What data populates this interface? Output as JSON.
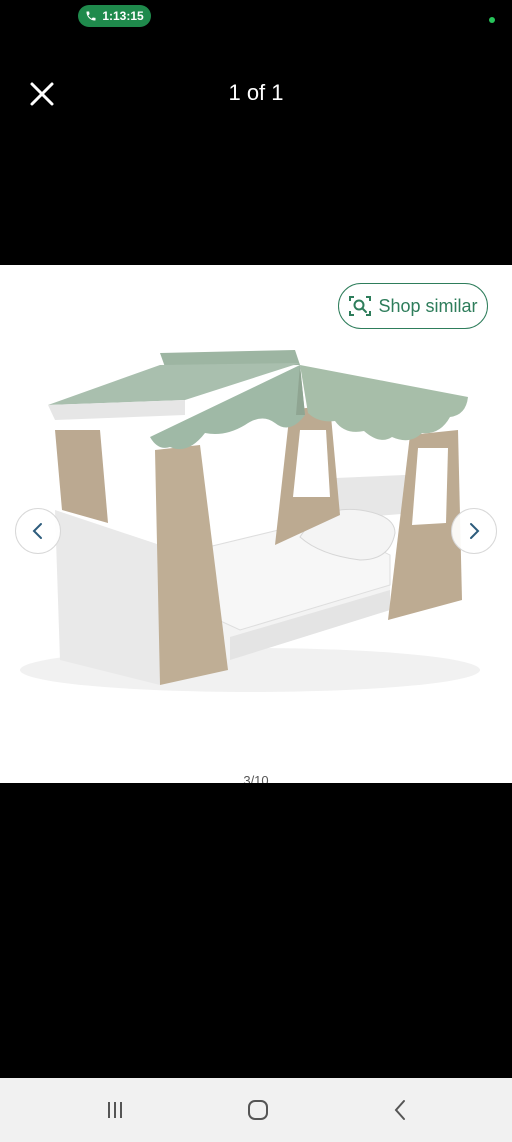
{
  "status_bar": {
    "call_time": "1:13:15",
    "icons": [
      "phone-icon",
      "status-dot-icon"
    ],
    "call_color": "#1f8a4c"
  },
  "top_bar": {
    "counter": "1 of 1",
    "close_icon": "close-icon"
  },
  "viewer": {
    "shop_similar_label": "Shop similar",
    "shop_similar_icon": "lens-search-icon",
    "prev_icon": "chevron-left-icon",
    "next_icon": "chevron-right-icon",
    "image_index": "3/10",
    "accent_color": "#2e7d5b"
  },
  "nav_bar": {
    "icons": [
      "recents-icon",
      "home-icon",
      "back-icon"
    ]
  }
}
